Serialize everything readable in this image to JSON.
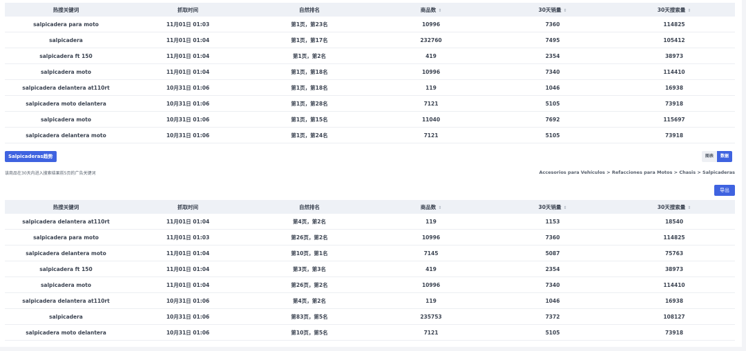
{
  "columns": [
    "热搜关键词",
    "抓取时间",
    "自然排名",
    "商品数",
    "30天销量",
    "30天搜索量"
  ],
  "sort_icon": "⇕",
  "table1": {
    "rows": [
      [
        "salpicadera para moto",
        "11月01日 01:03",
        "第1页，第23名",
        "10996",
        "7360",
        "114825"
      ],
      [
        "salpicadera",
        "11月01日 01:04",
        "第1页，第17名",
        "232760",
        "7495",
        "105412"
      ],
      [
        "salpicadera ft 150",
        "11月01日 01:04",
        "第1页，第2名",
        "419",
        "2354",
        "38973"
      ],
      [
        "salpicadera moto",
        "11月01日 01:04",
        "第1页，第18名",
        "10996",
        "7340",
        "114410"
      ],
      [
        "salpicadera delantera at110rt",
        "10月31日 01:06",
        "第1页，第18名",
        "119",
        "1046",
        "16938"
      ],
      [
        "salpicadera moto delantera",
        "10月31日 01:06",
        "第1页，第28名",
        "7121",
        "5105",
        "73918"
      ],
      [
        "salpicadera moto",
        "10月31日 01:06",
        "第1页，第15名",
        "11040",
        "7692",
        "115697"
      ],
      [
        "salpicadera delantera moto",
        "10月31日 01:06",
        "第1页，第24名",
        "7121",
        "5105",
        "73918"
      ]
    ]
  },
  "trend_button": "Salpicaderas趋势",
  "toggle": {
    "chart": "图表",
    "data": "数据"
  },
  "ad_note": "该商品在30天内进入搜索结果前5页的广告关键词",
  "breadcrumb": "Accesorios para Vehículos > Refacciones para Motos > Chasis > Salpicaderas",
  "export_button": "导出",
  "table2": {
    "rows": [
      [
        "salpicadera delantera at110rt",
        "11月01日 01:04",
        "第4页，第2名",
        "119",
        "1153",
        "18540"
      ],
      [
        "salpicadera para moto",
        "11月01日 01:03",
        "第26页，第2名",
        "10996",
        "7360",
        "114825"
      ],
      [
        "salpicadera delantera moto",
        "11月01日 01:04",
        "第10页，第1名",
        "7145",
        "5087",
        "75763"
      ],
      [
        "salpicadera ft 150",
        "11月01日 01:04",
        "第3页，第3名",
        "419",
        "2354",
        "38973"
      ],
      [
        "salpicadera moto",
        "11月01日 01:04",
        "第26页，第2名",
        "10996",
        "7340",
        "114410"
      ],
      [
        "salpicadera delantera at110rt",
        "10月31日 01:06",
        "第4页，第2名",
        "119",
        "1046",
        "16938"
      ],
      [
        "salpicadera",
        "10月31日 01:06",
        "第83页，第5名",
        "235753",
        "7372",
        "108127"
      ],
      [
        "salpicadera moto delantera",
        "10月31日 01:06",
        "第10页，第5名",
        "7121",
        "5105",
        "73918"
      ]
    ]
  }
}
